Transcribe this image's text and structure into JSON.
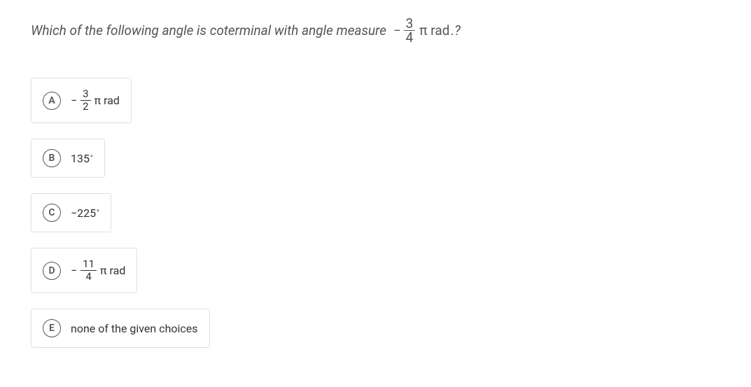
{
  "question": {
    "prefix": "Which of the following angle is coterminal with angle measure",
    "minus": "−",
    "frac_num": "3",
    "frac_den": "4",
    "pi_unit": "π rad",
    "suffix": ".?"
  },
  "choices": [
    {
      "letter": "A",
      "type": "frac",
      "minus": "−",
      "num": "3",
      "den": "2",
      "tail": "π rad"
    },
    {
      "letter": "B",
      "type": "deg",
      "text": "135",
      "deg": "°"
    },
    {
      "letter": "C",
      "type": "deg",
      "text": "−225",
      "deg": "°"
    },
    {
      "letter": "D",
      "type": "frac",
      "minus": "−",
      "num": "11",
      "den": "4",
      "tail": "π rad"
    },
    {
      "letter": "E",
      "type": "text",
      "text": "none of the given choices"
    }
  ]
}
